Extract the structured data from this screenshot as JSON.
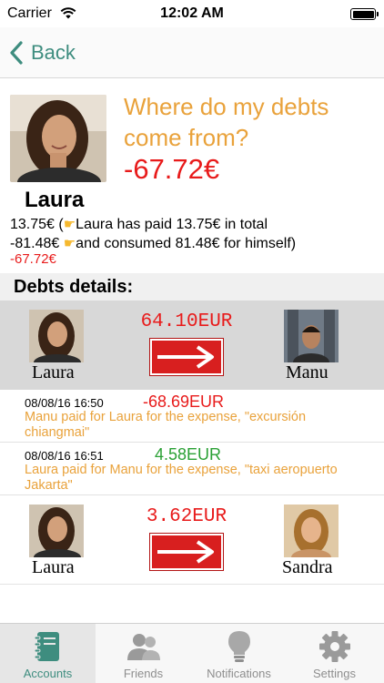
{
  "status_bar": {
    "carrier": "Carrier",
    "time": "12:02 AM"
  },
  "nav": {
    "back_label": "Back"
  },
  "header": {
    "headline": "Where do my debts come from?",
    "amount": "-67.72€",
    "name": "Laura"
  },
  "summary": {
    "total_amount": "13.75€",
    "total_text": "(",
    "total_desc": "Laura has paid 13.75€ in total",
    "consumed_amount": "-81.48€",
    "consumed_desc": "and consumed 81.48€ for himself)",
    "balance": "-67.72€"
  },
  "section": {
    "title": "Debts details:"
  },
  "debts": [
    {
      "from": "Laura",
      "to": "Manu",
      "amount": "64.10EUR"
    },
    {
      "from": "Laura",
      "to": "Sandra",
      "amount": "3.62EUR"
    }
  ],
  "expenses": [
    {
      "date": "08/08/16 16:50",
      "amount": "-68.69EUR",
      "desc": "Manu paid for Laura for the expense, \"excursión chiangmai\""
    },
    {
      "date": "08/08/16 16:51",
      "amount": "4.58EUR",
      "desc": "Laura paid for Manu for the expense, \"taxi aeropuerto Jakarta\""
    }
  ],
  "tabs": [
    {
      "label": "Accounts",
      "icon": "notebook-icon"
    },
    {
      "label": "Friends",
      "icon": "people-icon"
    },
    {
      "label": "Notifications",
      "icon": "lightbulb-icon"
    },
    {
      "label": "Settings",
      "icon": "gear-icon"
    }
  ],
  "colors": {
    "accent": "#3e8d7f",
    "headline": "#e9a23b",
    "negative": "#e81b1b",
    "positive": "#2aa035",
    "arrow": "#d81f1f"
  }
}
